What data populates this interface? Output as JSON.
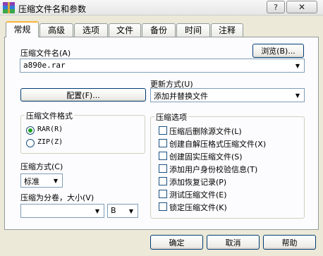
{
  "window": {
    "title": "压缩文件名和参数",
    "help_glyph": "?",
    "close_glyph": "✕",
    "icon": "winrar-books-icon"
  },
  "tabs": [
    {
      "label": "常规",
      "active": true
    },
    {
      "label": "高级",
      "active": false
    },
    {
      "label": "选项",
      "active": false
    },
    {
      "label": "文件",
      "active": false
    },
    {
      "label": "备份",
      "active": false
    },
    {
      "label": "时间",
      "active": false
    },
    {
      "label": "注释",
      "active": false
    }
  ],
  "general": {
    "archive_name_label": "压缩文件名(A)",
    "browse_button": "浏览(B)...",
    "archive_name_value": "a890e.rar",
    "update_mode_label": "更新方式(U)",
    "update_mode_value": "添加并替换文件",
    "profiles_button": "配置(F)...",
    "format_group": {
      "title": "压缩文件格式",
      "options": [
        {
          "label": "RAR(R)",
          "selected": true
        },
        {
          "label": "ZIP(Z)",
          "selected": false
        }
      ]
    },
    "method_label": "压缩方式(C)",
    "method_value": "标准",
    "split_label": "压缩为分卷，大小(V)",
    "split_value": "",
    "split_unit": "B",
    "options_group": {
      "title": "压缩选项",
      "items": [
        {
          "label": "压缩后删除源文件(L)",
          "checked": false
        },
        {
          "label": "创建自解压格式压缩文件(X)",
          "checked": false
        },
        {
          "label": "创建固实压缩文件(S)",
          "checked": false
        },
        {
          "label": "添加用户身份校验信息(T)",
          "checked": false
        },
        {
          "label": "添加恢复记录(P)",
          "checked": false
        },
        {
          "label": "测试压缩文件(E)",
          "checked": false
        },
        {
          "label": "锁定压缩文件(K)",
          "checked": false
        }
      ]
    }
  },
  "footer": {
    "ok": "确定",
    "cancel": "取消",
    "help": "帮助"
  }
}
